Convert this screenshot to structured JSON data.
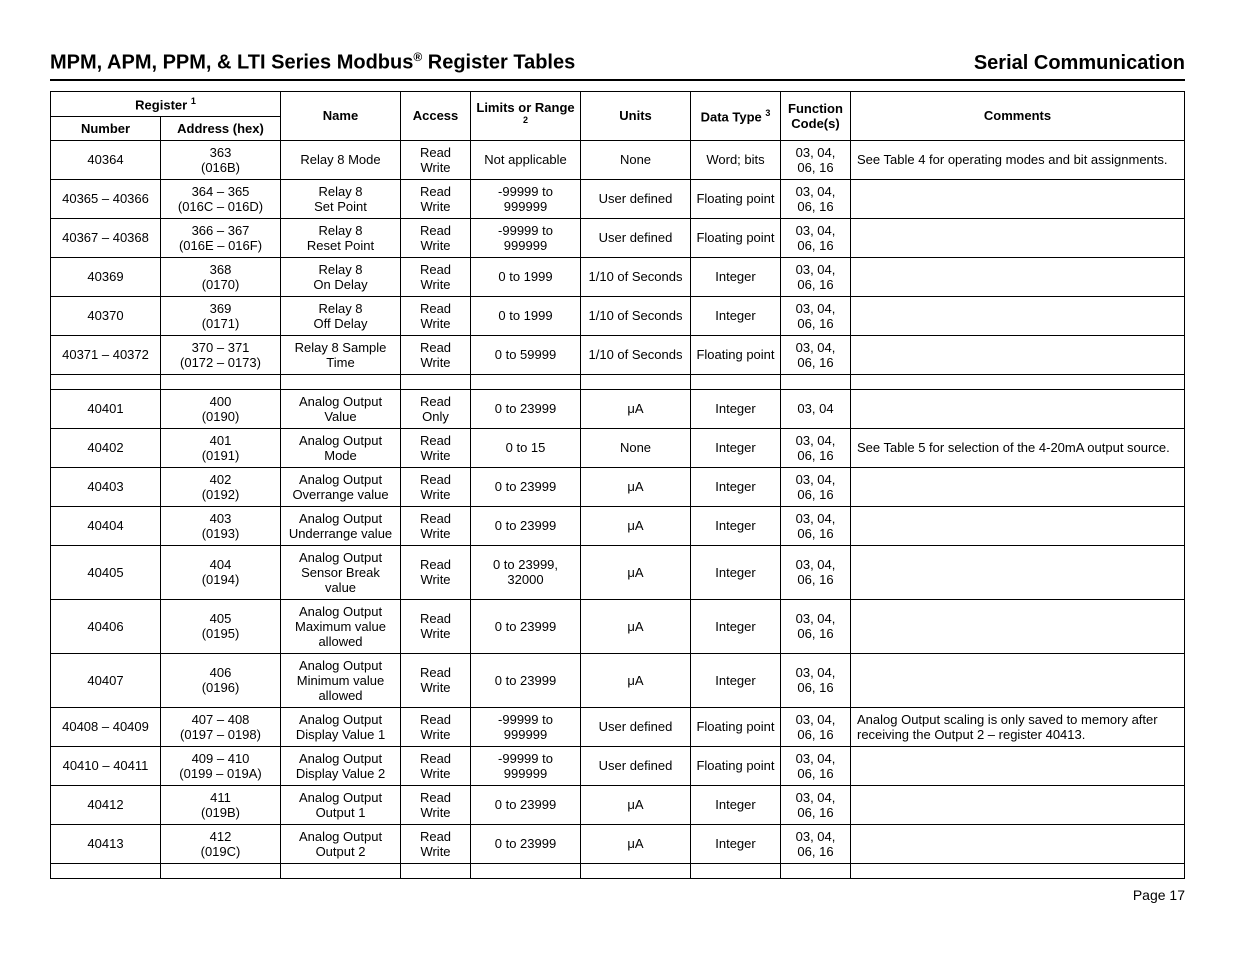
{
  "header": {
    "title_html": "MPM, APM, PPM, & LTI Series Modbus<sup>®</sup> Register Tables",
    "right": "Serial Communication"
  },
  "columns": {
    "register_header_html": "Register <sup>1</sup>",
    "number": "Number",
    "address": "Address (hex)",
    "name": "Name",
    "access": "Access",
    "limits_html": "Limits or Range <sup>2</sup>",
    "units": "Units",
    "data_type_html": "Data Type <sup>3</sup>",
    "fcode": "Function Code(s)",
    "comments": "Comments"
  },
  "rows": [
    {
      "num": "40364",
      "addr": "363\n(016B)",
      "name": "Relay 8 Mode",
      "access": "Read Write",
      "limits": "Not applicable",
      "units": "None",
      "dtype": "Word; bits",
      "fcode": "03, 04,\n06, 16",
      "comments": "See Table 4 for operating modes and bit assignments."
    },
    {
      "num": "40365 – 40366",
      "addr": "364 – 365\n(016C – 016D)",
      "name": "Relay 8\nSet Point",
      "access": "Read Write",
      "limits": "-99999 to 999999",
      "units": "User defined",
      "dtype": "Floating point",
      "fcode": "03, 04,\n06, 16",
      "comments": ""
    },
    {
      "num": "40367 – 40368",
      "addr": "366 – 367\n(016E – 016F)",
      "name": "Relay 8\nReset Point",
      "access": "Read Write",
      "limits": "-99999 to 999999",
      "units": "User defined",
      "dtype": "Floating point",
      "fcode": "03, 04,\n06, 16",
      "comments": ""
    },
    {
      "num": "40369",
      "addr": "368\n(0170)",
      "name": "Relay 8\nOn Delay",
      "access": "Read Write",
      "limits": "0 to 1999",
      "units": "1/10 of Seconds",
      "dtype": "Integer",
      "fcode": "03, 04,\n06, 16",
      "comments": ""
    },
    {
      "num": "40370",
      "addr": "369\n(0171)",
      "name": "Relay 8\nOff Delay",
      "access": "Read Write",
      "limits": "0 to 1999",
      "units": "1/10 of Seconds",
      "dtype": "Integer",
      "fcode": "03, 04,\n06, 16",
      "comments": ""
    },
    {
      "num": "40371 – 40372",
      "addr": "370 – 371\n(0172 – 0173)",
      "name": "Relay 8 Sample\nTime",
      "access": "Read Write",
      "limits": "0 to 59999",
      "units": "1/10 of Seconds",
      "dtype": "Floating point",
      "fcode": "03, 04,\n06, 16",
      "comments": ""
    },
    {
      "spacer": true
    },
    {
      "num": "40401",
      "addr": "400\n(0190)",
      "name": "Analog Output\nValue",
      "access": "Read Only",
      "limits": "0 to 23999",
      "units": "μA",
      "dtype": "Integer",
      "fcode": "03, 04",
      "comments": ""
    },
    {
      "num": "40402",
      "addr": "401\n(0191)",
      "name": "Analog Output\nMode",
      "access": "Read Write",
      "limits": "0 to 15",
      "units": "None",
      "dtype": "Integer",
      "fcode": "03, 04,\n06, 16",
      "comments": "See Table 5 for selection of the 4-20mA output source."
    },
    {
      "num": "40403",
      "addr": "402\n(0192)",
      "name": "Analog Output\nOverrange value",
      "access": "Read Write",
      "limits": "0 to 23999",
      "units": "μA",
      "dtype": "Integer",
      "fcode": "03, 04,\n06, 16",
      "comments": ""
    },
    {
      "num": "40404",
      "addr": "403\n(0193)",
      "name": "Analog Output\nUnderrange value",
      "access": "Read Write",
      "limits": "0 to 23999",
      "units": "μA",
      "dtype": "Integer",
      "fcode": "03, 04,\n06, 16",
      "comments": ""
    },
    {
      "num": "40405",
      "addr": "404\n(0194)",
      "name": "Analog Output\nSensor Break\nvalue",
      "access": "Read Write",
      "limits": "0 to 23999, 32000",
      "units": "μA",
      "dtype": "Integer",
      "fcode": "03, 04,\n06, 16",
      "comments": ""
    },
    {
      "num": "40406",
      "addr": "405\n(0195)",
      "name": "Analog Output\nMaximum value\nallowed",
      "access": "Read Write",
      "limits": "0 to 23999",
      "units": "μA",
      "dtype": "Integer",
      "fcode": "03, 04,\n06, 16",
      "comments": ""
    },
    {
      "num": "40407",
      "addr": "406\n(0196)",
      "name": "Analog Output\nMinimum value\nallowed",
      "access": "Read Write",
      "limits": "0 to 23999",
      "units": "μA",
      "dtype": "Integer",
      "fcode": "03, 04,\n06, 16",
      "comments": ""
    },
    {
      "num": "40408 – 40409",
      "addr": "407 – 408\n(0197 – 0198)",
      "name": "Analog Output\nDisplay Value 1",
      "access": "Read Write",
      "limits": "-99999 to 999999",
      "units": "User defined",
      "dtype": "Floating point",
      "fcode": "03, 04,\n06, 16",
      "comments": "Analog Output scaling is only saved to memory after receiving the Output 2 – register 40413."
    },
    {
      "num": "40410 – 40411",
      "addr": "409 – 410\n(0199 – 019A)",
      "name": "Analog Output\nDisplay Value 2",
      "access": "Read Write",
      "limits": "-99999 to 999999",
      "units": "User defined",
      "dtype": "Floating point",
      "fcode": "03, 04,\n06, 16",
      "comments": ""
    },
    {
      "num": "40412",
      "addr": "411\n(019B)",
      "name": "Analog Output\nOutput 1",
      "access": "Read Write",
      "limits": "0 to 23999",
      "units": "μA",
      "dtype": "Integer",
      "fcode": "03, 04,\n06, 16",
      "comments": ""
    },
    {
      "num": "40413",
      "addr": "412\n(019C)",
      "name": "Analog Output\nOutput 2",
      "access": "Read Write",
      "limits": "0 to 23999",
      "units": "μA",
      "dtype": "Integer",
      "fcode": "03, 04,\n06, 16",
      "comments": ""
    },
    {
      "spacer": true
    }
  ],
  "footer": {
    "page": "Page 17"
  }
}
